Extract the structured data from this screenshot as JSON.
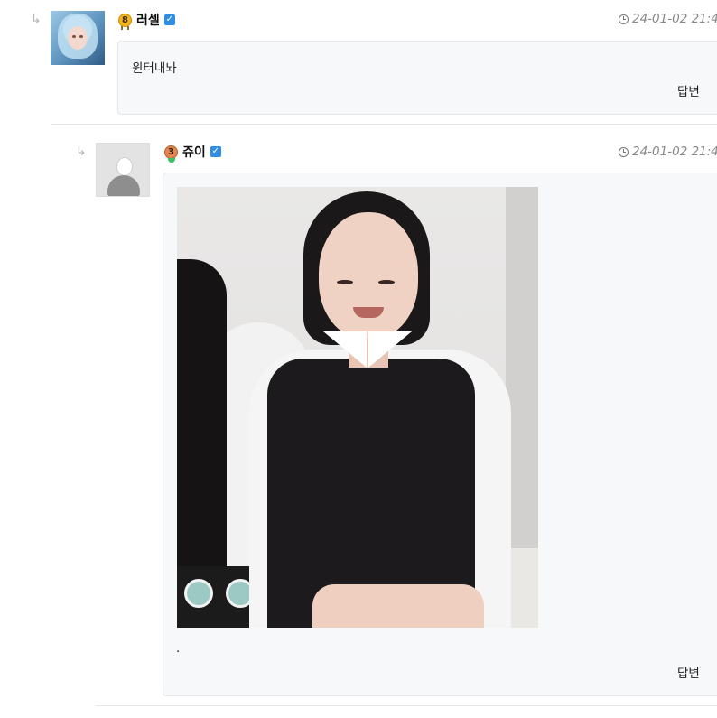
{
  "comments": [
    {
      "author": "러셀",
      "level": "8",
      "datetime": "24-01-02 21:4",
      "text": "윈터내놔",
      "reply_label": "답변"
    },
    {
      "author": "쥬이",
      "level": "3",
      "datetime": "24-01-02 21:4",
      "text": ".",
      "reply_label": "답변"
    }
  ],
  "icons": {
    "reply_arrow": "↳",
    "verified": "✓"
  },
  "colors": {
    "bubble_bg": "#f7f8fa",
    "verified": "#2f8de4",
    "level_8": "#f2b41c",
    "level_3": "#e0874f"
  }
}
